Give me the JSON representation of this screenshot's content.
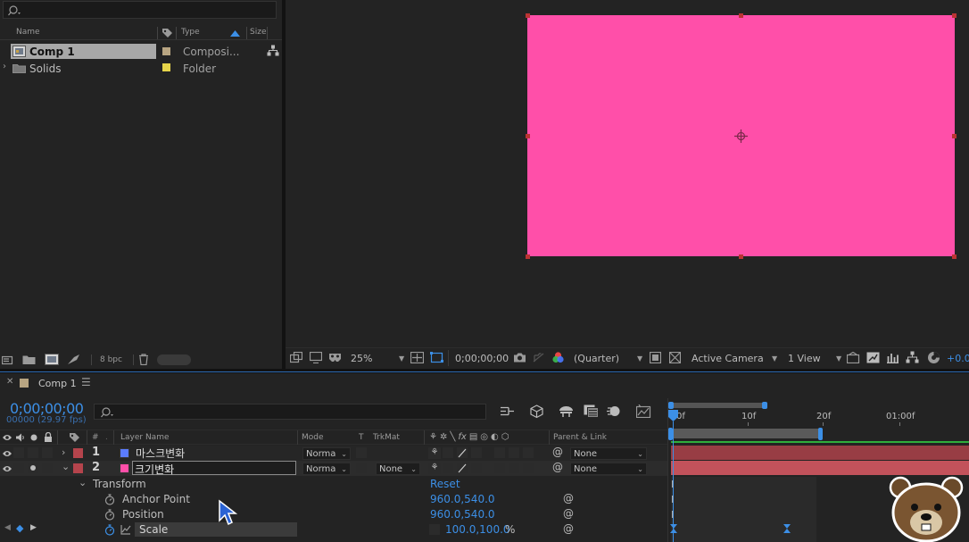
{
  "project_panel": {
    "search_placeholder": "",
    "columns": {
      "name": "Name",
      "type": "Type",
      "size": "Size"
    },
    "items": [
      {
        "name": "Comp 1",
        "type": "Composi...",
        "color": "#b8a582"
      },
      {
        "name": "Solids",
        "type": "Folder",
        "color": "#e6d44a"
      }
    ],
    "bpc": "8 bpc"
  },
  "viewer": {
    "comp_color": "#ff4fa9",
    "zoom": "25%",
    "timecode": "0;00;00;00",
    "resolution": "(Quarter)",
    "camera": "Active Camera",
    "views": "1 View",
    "exposure": "+0.0"
  },
  "timeline": {
    "tab_title": "Comp 1",
    "current_time": "0;00;00;00",
    "frame_info": "00000 (29.97 fps)",
    "columns": {
      "hash": "#",
      "layer_name": "Layer Name",
      "mode": "Mode",
      "t": "T",
      "trkmat": "TrkMat",
      "parent_link": "Parent & Link"
    },
    "layers": [
      {
        "index": "1",
        "name": "마스크변화",
        "mode": "Norma",
        "trkmat": "",
        "parent": "None",
        "label_color": "#5b7cff",
        "bar_color": "#b5444c"
      },
      {
        "index": "2",
        "name": "크기변화",
        "mode": "Norma",
        "trkmat": "None",
        "parent": "None",
        "label_color": "#ff4fa9",
        "bar_color": "#b5444c"
      }
    ],
    "transform": {
      "label": "Transform",
      "reset": "Reset",
      "properties": [
        {
          "name": "Anchor Point",
          "value": "960.0,540.0",
          "unit": ""
        },
        {
          "name": "Position",
          "value": "960.0,540.0",
          "unit": ""
        },
        {
          "name": "Scale",
          "value": "100.0,100.0",
          "unit": "%"
        }
      ]
    },
    "ruler": [
      "0f",
      "10f",
      "20f",
      "01:00f"
    ]
  }
}
